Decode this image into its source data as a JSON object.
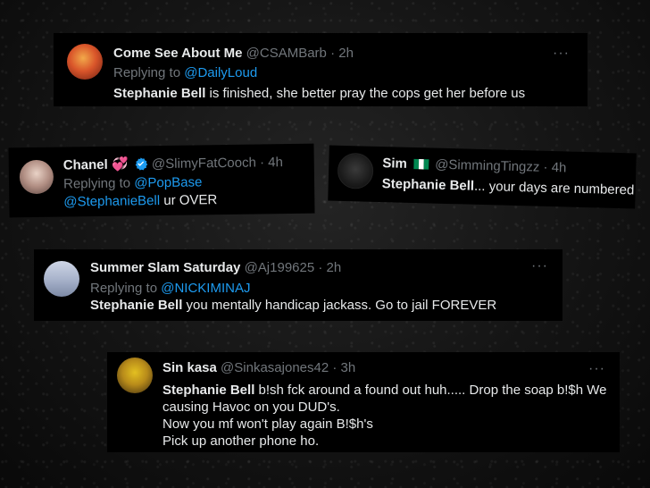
{
  "tweets": [
    {
      "name": "Come See About Me",
      "handle": "@CSAMBarb",
      "time": "· 2h",
      "replying_prefix": "Replying to",
      "replying_to": "@DailyLoud",
      "body_bold": "Stephanie Bell",
      "body_rest": " is finished, she better pray the cops get her before us",
      "more": "···"
    },
    {
      "name": "Chanel",
      "name_emoji": "💞",
      "handle": "@SlimyFatCooch",
      "time": "· 4h",
      "replying_prefix": "Replying to",
      "replying_to": "@PopBase",
      "body_link": "@StephanieBell",
      "body_rest": " ur OVER",
      "verified_color": "#1d9bf0"
    },
    {
      "name": "Sim",
      "handle": "@SimmingTingzz",
      "time": "· 4h",
      "body_bold": "Stephanie Bell",
      "body_rest": "... your days are numbered"
    },
    {
      "name": "Summer Slam Saturday",
      "handle": "@Aj199625",
      "time": "· 2h",
      "replying_prefix": "Replying to",
      "replying_to": "@NICKIMINAJ",
      "body_bold": "Stephanie Bell",
      "body_rest": " you mentally handicap jackass. Go to jail FOREVER",
      "more": "···"
    },
    {
      "name": "Sin kasa",
      "handle": "@Sinkasajones42",
      "time": "· 3h",
      "body_bold": "Stephanie Bell",
      "body_line1_rest": " b!sh  fck around a found out huh..... Drop the soap b!$h We",
      "body_line2": "causing Havoc on you DUD's.",
      "body_line3": "Now you mf won't play again B!$h's",
      "body_line4": "Pick up another phone ho.",
      "more": "···"
    }
  ],
  "colors": {
    "card_bg": "#000000",
    "text": "#e7e9ea",
    "muted": "#71767b",
    "link": "#1d9bf0"
  }
}
